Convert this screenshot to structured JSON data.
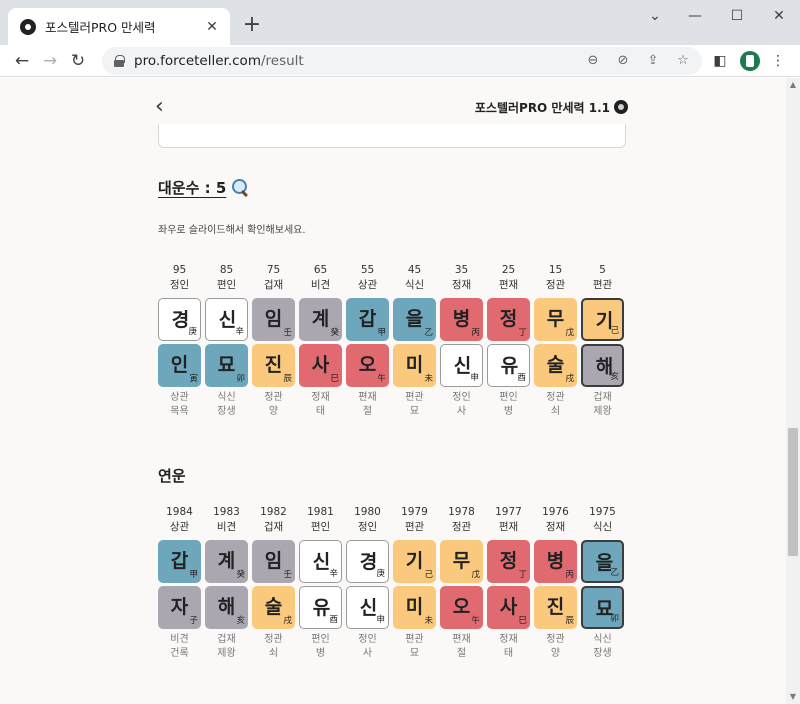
{
  "browser": {
    "tab_title": "포스텔러PRO 만세력",
    "tab_close": "✕",
    "new_tab": "+",
    "url_host": "pro.forceteller.com",
    "url_path": "/result",
    "win_minimize": "—",
    "win_maximize": "☐",
    "win_close": "✕",
    "win_chevron": "⌄"
  },
  "header": {
    "back": "‹",
    "title": "포스텔러PRO 만세력 1.1"
  },
  "daeun": {
    "title": "대운수 : 5",
    "hint": "좌우로 슬라이드해서 확인해보세요.",
    "columns": [
      {
        "num": "95",
        "ten": "정인",
        "top": "경",
        "top_han": "庚",
        "top_color": "white",
        "bottom": "인",
        "bottom_han": "寅",
        "bottom_color": "blue",
        "foot1": "상관",
        "foot2": "목욕",
        "selected": false
      },
      {
        "num": "85",
        "ten": "편인",
        "top": "신",
        "top_han": "辛",
        "top_color": "white",
        "bottom": "묘",
        "bottom_han": "卯",
        "bottom_color": "blue",
        "foot1": "식신",
        "foot2": "장생",
        "selected": false
      },
      {
        "num": "75",
        "ten": "겁재",
        "top": "임",
        "top_han": "壬",
        "top_color": "gray",
        "bottom": "진",
        "bottom_han": "辰",
        "bottom_color": "yellow",
        "foot1": "정관",
        "foot2": "양",
        "selected": false
      },
      {
        "num": "65",
        "ten": "비견",
        "top": "계",
        "top_han": "癸",
        "top_color": "gray",
        "bottom": "사",
        "bottom_han": "巳",
        "bottom_color": "red",
        "foot1": "정재",
        "foot2": "태",
        "selected": false
      },
      {
        "num": "55",
        "ten": "상관",
        "top": "갑",
        "top_han": "甲",
        "top_color": "blue",
        "bottom": "오",
        "bottom_han": "午",
        "bottom_color": "red",
        "foot1": "편재",
        "foot2": "절",
        "selected": false
      },
      {
        "num": "45",
        "ten": "식신",
        "top": "을",
        "top_han": "乙",
        "top_color": "blue",
        "bottom": "미",
        "bottom_han": "未",
        "bottom_color": "yellow",
        "foot1": "편관",
        "foot2": "묘",
        "selected": false
      },
      {
        "num": "35",
        "ten": "정재",
        "top": "병",
        "top_han": "丙",
        "top_color": "red",
        "bottom": "신",
        "bottom_han": "申",
        "bottom_color": "white",
        "foot1": "정인",
        "foot2": "사",
        "selected": false
      },
      {
        "num": "25",
        "ten": "편재",
        "top": "정",
        "top_han": "丁",
        "top_color": "red",
        "bottom": "유",
        "bottom_han": "酉",
        "bottom_color": "white",
        "foot1": "편인",
        "foot2": "병",
        "selected": false
      },
      {
        "num": "15",
        "ten": "정관",
        "top": "무",
        "top_han": "戊",
        "top_color": "yellow",
        "bottom": "술",
        "bottom_han": "戌",
        "bottom_color": "yellow",
        "foot1": "정관",
        "foot2": "쇠",
        "selected": false
      },
      {
        "num": "5",
        "ten": "편관",
        "top": "기",
        "top_han": "己",
        "top_color": "yellow",
        "bottom": "해",
        "bottom_han": "亥",
        "bottom_color": "gray",
        "foot1": "겁재",
        "foot2": "제왕",
        "selected": true
      }
    ]
  },
  "yeonun": {
    "title": "연운",
    "columns": [
      {
        "num": "1984",
        "ten": "상관",
        "top": "갑",
        "top_han": "甲",
        "top_color": "blue",
        "bottom": "자",
        "bottom_han": "子",
        "bottom_color": "gray",
        "foot1": "비견",
        "foot2": "건록",
        "selected": false
      },
      {
        "num": "1983",
        "ten": "비견",
        "top": "계",
        "top_han": "癸",
        "top_color": "gray",
        "bottom": "해",
        "bottom_han": "亥",
        "bottom_color": "gray",
        "foot1": "겁재",
        "foot2": "제왕",
        "selected": false
      },
      {
        "num": "1982",
        "ten": "겁재",
        "top": "임",
        "top_han": "壬",
        "top_color": "gray",
        "bottom": "술",
        "bottom_han": "戌",
        "bottom_color": "yellow",
        "foot1": "정관",
        "foot2": "쇠",
        "selected": false
      },
      {
        "num": "1981",
        "ten": "편인",
        "top": "신",
        "top_han": "辛",
        "top_color": "white",
        "bottom": "유",
        "bottom_han": "酉",
        "bottom_color": "white",
        "foot1": "편인",
        "foot2": "병",
        "selected": false
      },
      {
        "num": "1980",
        "ten": "정인",
        "top": "경",
        "top_han": "庚",
        "top_color": "white",
        "bottom": "신",
        "bottom_han": "申",
        "bottom_color": "white",
        "foot1": "정인",
        "foot2": "사",
        "selected": false
      },
      {
        "num": "1979",
        "ten": "편관",
        "top": "기",
        "top_han": "己",
        "top_color": "yellow",
        "bottom": "미",
        "bottom_han": "未",
        "bottom_color": "yellow",
        "foot1": "편관",
        "foot2": "묘",
        "selected": false
      },
      {
        "num": "1978",
        "ten": "정관",
        "top": "무",
        "top_han": "戊",
        "top_color": "yellow",
        "bottom": "오",
        "bottom_han": "午",
        "bottom_color": "red",
        "foot1": "편재",
        "foot2": "절",
        "selected": false
      },
      {
        "num": "1977",
        "ten": "편재",
        "top": "정",
        "top_han": "丁",
        "top_color": "red",
        "bottom": "사",
        "bottom_han": "巳",
        "bottom_color": "red",
        "foot1": "정재",
        "foot2": "태",
        "selected": false
      },
      {
        "num": "1976",
        "ten": "정재",
        "top": "병",
        "top_han": "丙",
        "top_color": "red",
        "bottom": "진",
        "bottom_han": "辰",
        "bottom_color": "yellow",
        "foot1": "정관",
        "foot2": "양",
        "selected": false
      },
      {
        "num": "1975",
        "ten": "식신",
        "top": "을",
        "top_han": "乙",
        "top_color": "blue",
        "bottom": "묘",
        "bottom_han": "卯",
        "bottom_color": "blue",
        "foot1": "식신",
        "foot2": "장생",
        "selected": true
      }
    ]
  },
  "colors": {
    "white": "#ffffff",
    "gray": "#aaa7b0",
    "blue": "#6ea6bc",
    "red": "#e16a70",
    "yellow": "#fbc97d",
    "background": "#faf9f7"
  },
  "icons": {
    "favicon": "forceteller-logo-icon",
    "lock": "lock-icon",
    "zoom": "zoom-icon",
    "eye_off": "eye-off-icon",
    "share": "share-icon",
    "bookmark": "star-icon",
    "extensions": "sidepanel-icon",
    "menu": "kebab-menu-icon",
    "magnifier": "magnifier-icon"
  }
}
